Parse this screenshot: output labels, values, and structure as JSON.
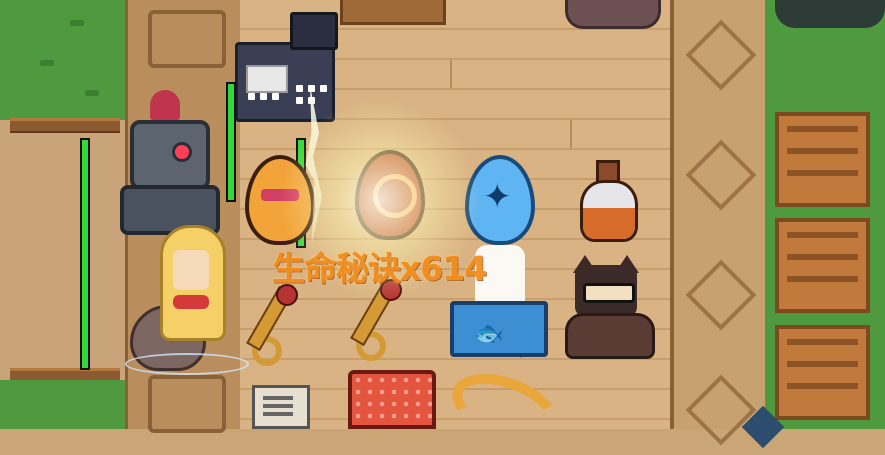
{
  "effects": {
    "reward_text": "生命秘诀x614"
  },
  "icons": [
    "cash-register-icon",
    "knight-icon",
    "mermaid-icon",
    "golden-egg-icon",
    "red-egg-icon",
    "blue-egg-icon",
    "potion-icon",
    "staff-icon",
    "fish-can-icon",
    "cat-shopkeeper-icon",
    "notebook-icon",
    "red-book-icon",
    "horn-icon"
  ],
  "health": {
    "left_ally": 1.0,
    "knight": 1.0,
    "register_side": 1.0,
    "egg_side": 1.0
  },
  "colors": {
    "reward_text": "#f28a17",
    "health_fill": "#35d83a",
    "grass": "#4f9a3e",
    "floor": "#d9b383"
  }
}
